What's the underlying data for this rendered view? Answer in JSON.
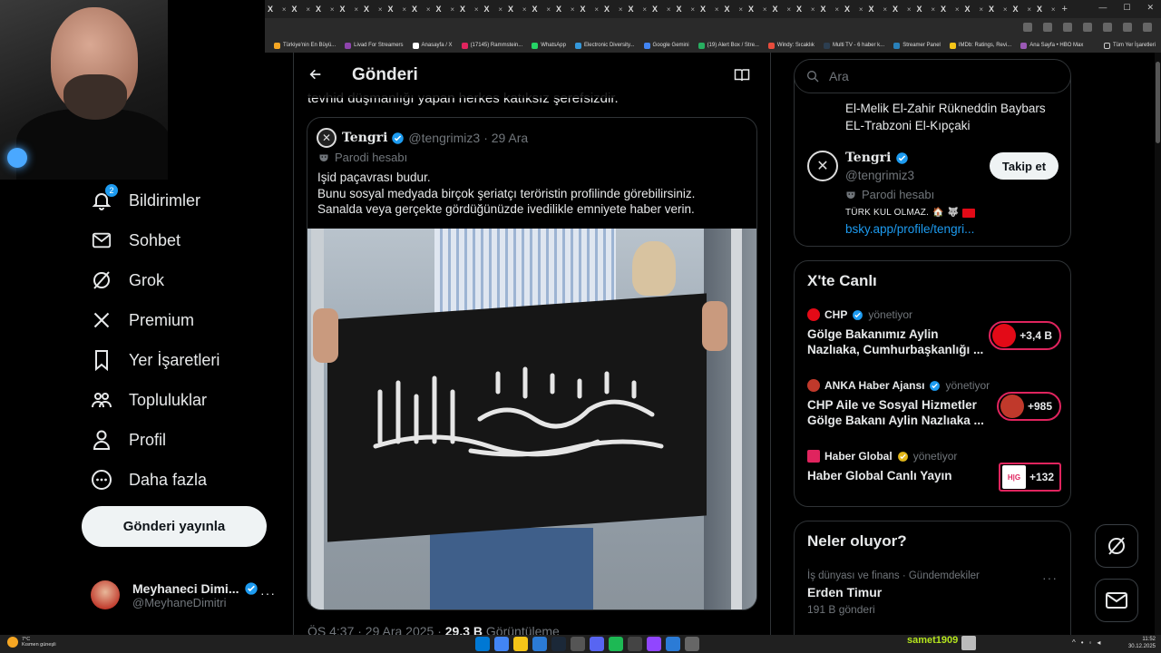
{
  "browser": {
    "tab_count": 33,
    "tab_glyph": "X",
    "tab_close": "×",
    "new_tab": "+",
    "bookmarks": [
      {
        "label": "Türkiye'nin En Büyü...",
        "color": "#f5a623"
      },
      {
        "label": "Livad For Streamers",
        "color": "#8e44ad"
      },
      {
        "label": "Anasayfa / X",
        "color": "#ffffff"
      },
      {
        "label": "(17145) Rammstein...",
        "color": "#e0245e"
      },
      {
        "label": "WhatsApp",
        "color": "#25d366"
      },
      {
        "label": "Electronic Diversity...",
        "color": "#3498db"
      },
      {
        "label": "Google Gemini",
        "color": "#4285f4"
      },
      {
        "label": "(19) Alert Box / Stre...",
        "color": "#27ae60"
      },
      {
        "label": "Windy: Sıcaklık",
        "color": "#e74c3c"
      },
      {
        "label": "Multi TV - 6 haber k...",
        "color": "#2c3e50"
      },
      {
        "label": "Streamer Panel",
        "color": "#2980b9"
      },
      {
        "label": "IMDb: Ratings, Revi...",
        "color": "#f5c518"
      },
      {
        "label": "Ana Sayfa • HBO Max",
        "color": "#9b59b6"
      }
    ],
    "all_bookmarks": "Tüm Yer İşaretleri"
  },
  "nav": {
    "notifications_badge": "2",
    "items": [
      {
        "label": "Bildirimler",
        "icon": "bell-icon"
      },
      {
        "label": "Sohbet",
        "icon": "mail-icon"
      },
      {
        "label": "Grok",
        "icon": "grok-icon"
      },
      {
        "label": "Premium",
        "icon": "x-logo-icon"
      },
      {
        "label": "Yer İşaretleri",
        "icon": "bookmark-icon"
      },
      {
        "label": "Topluluklar",
        "icon": "communities-icon"
      },
      {
        "label": "Profil",
        "icon": "person-icon"
      },
      {
        "label": "Daha fazla",
        "icon": "more-circle-icon"
      }
    ],
    "post_button": "Gönderi yayınla",
    "account": {
      "name": "Meyhaneci Dimi...",
      "handle": "@MeyhaneDimitri",
      "more": "···"
    }
  },
  "main": {
    "title": "Gönderi",
    "previous_text": "tevhid düşmanlığı yapan herkes katıksız şerefsizdir.",
    "quote": {
      "name": "Tengri",
      "handle": "@tengrimiz3",
      "date": "· 29 Ara",
      "parody": "Parodi hesabı",
      "lines": [
        "Işid paçavrası budur.",
        "Bunu sosyal medyada birçok şeriatçı teröristin profilinde görebilirsiniz.",
        "Sanalda veya gerçekte gördüğünüzde ivedilikle emniyete haber verin."
      ]
    },
    "meta": {
      "time": "ÖS 4:37 · 29 Ara 2025 · ",
      "views": "29,3 B",
      "views_label": " Görüntüleme"
    }
  },
  "right": {
    "search_placeholder": "Ara",
    "profile": {
      "previous_bio": [
        "El-Melik El-Zahir Rükneddin Baybars",
        "EL-Trabzoni El-Kıpçaki"
      ],
      "name": "Tengri",
      "handle": "@tengrimiz3",
      "parody": "Parodi hesabı",
      "bio": "TÜRK KUL OLMAZ.",
      "link": "bsky.app/profile/tengri...",
      "follow": "Takip et"
    },
    "live": {
      "title": "X'te Canlı",
      "items": [
        {
          "source": "CHP",
          "hosting": "yönetiyor",
          "title": "Gölge Bakanımız Aylin Nazlıaka, Cumhurbaşkanlığı ...",
          "count": "+3,4 B",
          "color": "#e30a17"
        },
        {
          "source": "ANKA Haber Ajansı",
          "hosting": "yönetiyor",
          "title": "CHP Aile ve Sosyal Hizmetler Gölge Bakanı Aylin Nazlıaka ...",
          "count": "+985",
          "color": "#c0392b"
        },
        {
          "source": "Haber Global",
          "hosting": "yönetiyor",
          "title": "Haber Global Canlı Yayın",
          "count": "+132",
          "color": "#e0245e",
          "thumb": "H|G"
        }
      ]
    },
    "trends": {
      "title": "Neler oluyor?",
      "category": "İş dünyası ve finans · Gündemdekiler",
      "name": "Erden Timur",
      "count": "191 B gönderi",
      "more": "···"
    }
  },
  "taskbar": {
    "weather_temp": "7°C",
    "weather_desc": "Kısmen güneşli",
    "user": "samet1909",
    "time": "11:52",
    "date": "30.12.2025"
  }
}
